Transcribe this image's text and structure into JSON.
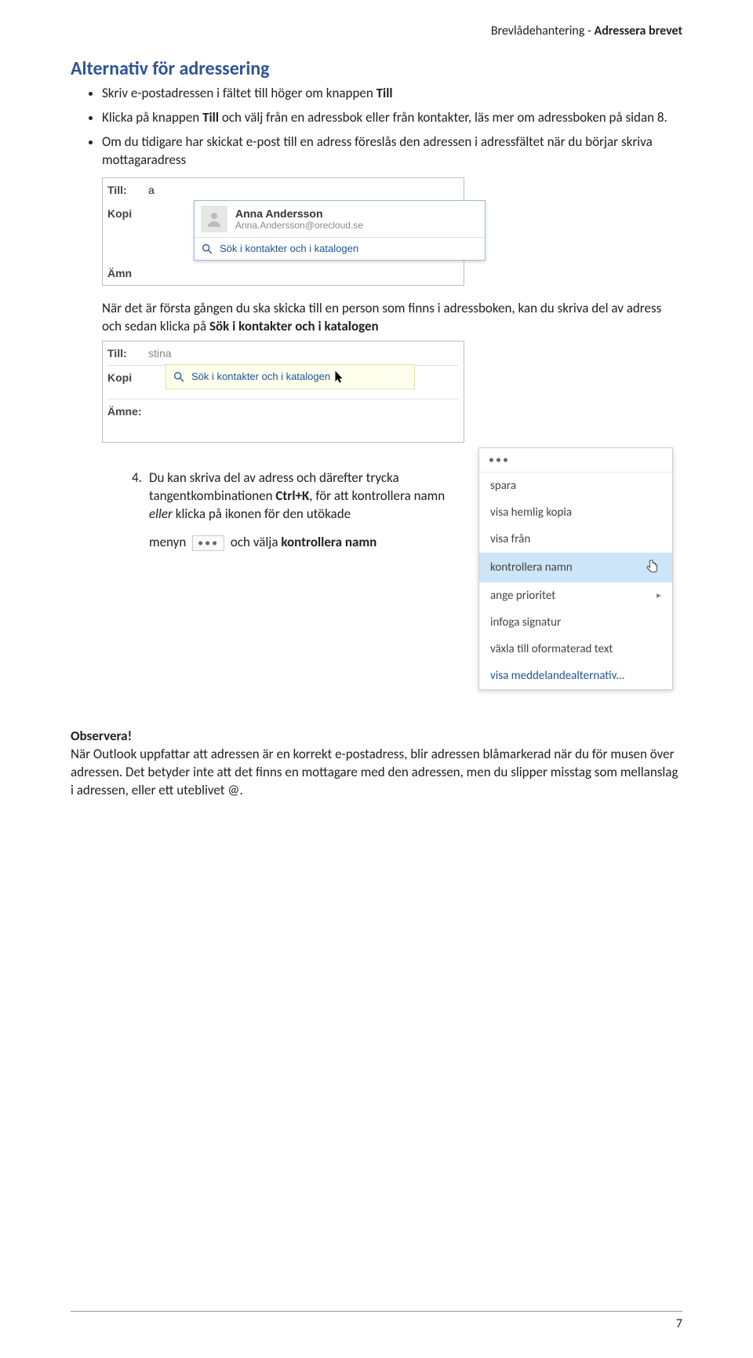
{
  "running_head": {
    "left": "Brevlådehantering - ",
    "right": "Adressera brevet"
  },
  "section_title": "Alternativ för adressering",
  "bullets": [
    {
      "pre": "Skriv e-postadressen i fältet till höger om knappen ",
      "b": "Till"
    },
    {
      "pre": "Klicka på knappen ",
      "b": "Till",
      "post": " och välj från en adressbok eller från kontakter, läs mer om adressboken på sidan 8."
    },
    {
      "pre": "Om du tidigare har skickat e-post till en adress föreslås den adressen i adressfältet när du börjar skriva mottagaradress"
    }
  ],
  "shot1": {
    "till_label": "Till:",
    "till_value": "a",
    "kopia_label": "Kopi",
    "amne_label": "Ämn",
    "suggest_name": "Anna Andersson",
    "suggest_email": "Anna.Andersson@orecloud.se",
    "search_label": "Sök i kontakter och i katalogen"
  },
  "para_first_time": {
    "pre": "När det är första gången du ska skicka till en person som finns i adressboken, kan du skriva del av adress och sedan klicka på ",
    "b": "Sök i kontakter och i katalogen"
  },
  "shot2": {
    "till_label": "Till:",
    "till_value": "stina",
    "kopia_label": "Kopi",
    "amne_label": "Ämne:",
    "search_label": "Sök i kontakter och i katalogen"
  },
  "step4": {
    "num": "4.",
    "line1_pre": "Du kan skriva del av adress och därefter trycka tangentkombinationen ",
    "line1_b": "Ctrl+K",
    "line1_mid": ", för att kontrollera namn ",
    "line1_it": "eller",
    "line1_post": " klicka på ikonen för den utökade",
    "line2_pre": "menyn ",
    "line2_post": " och välja ",
    "line2_b": "kontrollera namn"
  },
  "ctx": {
    "items": [
      {
        "label": "spara"
      },
      {
        "label": "visa hemlig kopia"
      },
      {
        "label": "visa från"
      },
      {
        "label": "kontrollera namn",
        "highlight": true,
        "hand": true
      },
      {
        "label": "ange prioritet",
        "arrow": true
      },
      {
        "label": "infoga signatur"
      },
      {
        "label": "växla till oformaterad text"
      },
      {
        "label": "visa meddelandealternativ...",
        "link": true
      }
    ]
  },
  "observe": {
    "title": "Observera!",
    "body": "När Outlook uppfattar att adressen är en korrekt e-postadress, blir adressen blåmarkerad när du för musen över adressen. Det betyder inte att det finns en mottagare med den adressen, men du slipper misstag som mellanslag i adressen, eller ett uteblivet @."
  },
  "page_number": "7"
}
